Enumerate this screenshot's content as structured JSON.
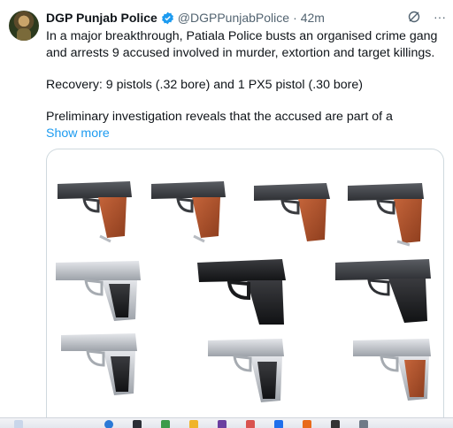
{
  "tweet": {
    "author_name": "DGP Punjab Police",
    "handle": "@DGPPunjabPolice",
    "separator": "·",
    "time": "42m",
    "more_icon": "···",
    "text_para1": "In a major breakthrough, Patiala Police busts an organised crime gang and arrests 9 accused involved in murder, extortion and target killings.",
    "text_para2": "Recovery: 9 pistols (.32 bore) and 1 PX5 pistol (.30 bore)",
    "text_para3": "Preliminary investigation reveals that the accused are part of a",
    "show_more": "Show more"
  },
  "icons": {
    "verified": "verified-badge-icon",
    "grok": "grok-icon",
    "more": "more-options-icon"
  },
  "colors": {
    "link": "#1d9bf0",
    "secondary_text": "#536471",
    "verified": "#1d9bf0"
  },
  "media": {
    "description_alt": "",
    "items": [
      {
        "row": 1,
        "col": 1,
        "grip": "wood"
      },
      {
        "row": 1,
        "col": 2,
        "grip": "wood"
      },
      {
        "row": 1,
        "col": 3,
        "grip": "wood"
      },
      {
        "row": 1,
        "col": 4,
        "grip": "wood"
      },
      {
        "row": 2,
        "col": 1,
        "grip": "black-silver"
      },
      {
        "row": 2,
        "col": 2,
        "grip": "black-polymer"
      },
      {
        "row": 2,
        "col": 3,
        "grip": "black-dark"
      },
      {
        "row": 3,
        "col": 1,
        "grip": "black-silver"
      },
      {
        "row": 3,
        "col": 2,
        "grip": "black-silver"
      },
      {
        "row": 3,
        "col": 3,
        "grip": "wood-silver"
      }
    ]
  }
}
